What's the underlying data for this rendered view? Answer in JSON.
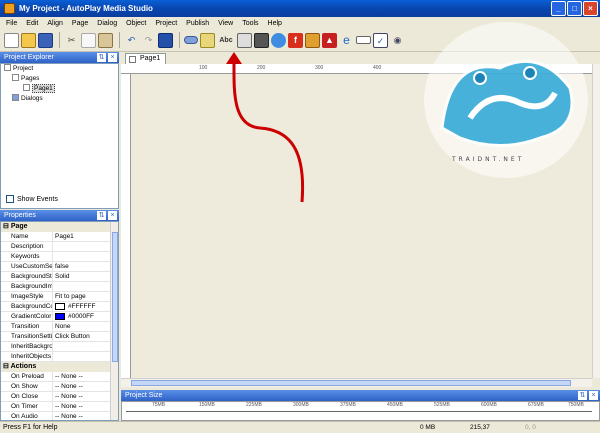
{
  "window": {
    "title": "My Project - AutoPlay Media Studio"
  },
  "menu": [
    "File",
    "Edit",
    "Align",
    "Page",
    "Dialog",
    "Object",
    "Project",
    "Publish",
    "View",
    "Tools",
    "Help"
  ],
  "toolbar": {
    "items": [
      "new-icon",
      "open-icon",
      "save-icon",
      "cut-icon",
      "copy-icon",
      "paste-icon",
      "undo-icon",
      "redo-icon",
      "preview-icon",
      "button-object-icon",
      "label-object-icon",
      "paragraph-object-icon",
      "image-object-icon",
      "flash-object-icon",
      "pdf-object-icon",
      "web-object-icon",
      "input-object-icon",
      "checkbox-object-icon",
      "radio-object-icon"
    ],
    "label_glyph": "Abc"
  },
  "project_explorer": {
    "header": "Project Explorer",
    "tree": [
      {
        "label": "Project",
        "depth": 0
      },
      {
        "label": "Pages",
        "depth": 1
      },
      {
        "label": "Page1",
        "depth": 2
      },
      {
        "label": "Dialogs",
        "depth": 1
      }
    ],
    "show_events": "Show Events"
  },
  "properties": {
    "header": "Properties",
    "page_category": "Page",
    "rows": [
      {
        "key": "Name",
        "value": "Page1"
      },
      {
        "key": "Description",
        "value": ""
      },
      {
        "key": "Keywords",
        "value": ""
      },
      {
        "key": "UseCustomSettin",
        "value": "false"
      },
      {
        "key": "BackgroundStyle",
        "value": "Solid"
      },
      {
        "key": "BackgroundImage",
        "value": ""
      },
      {
        "key": "ImageStyle",
        "value": "Fit to page"
      },
      {
        "key": "BackgroundColor",
        "value": "#FFFFFF",
        "swatch": "#FFFFFF"
      },
      {
        "key": "GradientColor",
        "value": "#0000FF",
        "swatch": "#0000FF"
      },
      {
        "key": "Transition",
        "value": "None"
      },
      {
        "key": "TransitionSetting",
        "value": "Click Button"
      },
      {
        "key": "InheritBackgroun",
        "value": ""
      },
      {
        "key": "InheritObjects",
        "value": ""
      }
    ],
    "actions_category": "Actions",
    "actions": [
      {
        "key": "On Preload",
        "value": "-- None --"
      },
      {
        "key": "On Show",
        "value": "-- None --"
      },
      {
        "key": "On Close",
        "value": "-- None --"
      },
      {
        "key": "On Timer",
        "value": "-- None --"
      },
      {
        "key": "On Audio",
        "value": "-- None --"
      }
    ]
  },
  "document": {
    "tab": "Page1",
    "ruler_marks": [
      "100",
      "200",
      "300",
      "400"
    ]
  },
  "project_size": {
    "header": "Project Size",
    "ticks": [
      "75MB",
      "150MB",
      "225MB",
      "300MB",
      "375MB",
      "450MB",
      "525MB",
      "600MB",
      "675MB",
      "750MB"
    ]
  },
  "statusbar": {
    "help": "Press F1 for Help",
    "size": "0 MB",
    "position": "215,37",
    "dims": "0, 0"
  },
  "watermark": {
    "url": "TRAIDNT.NET"
  },
  "colors": {
    "title_blue": "#0846b0",
    "arrow_red": "#cc0000",
    "logo_blue": "#2aa6d6"
  }
}
